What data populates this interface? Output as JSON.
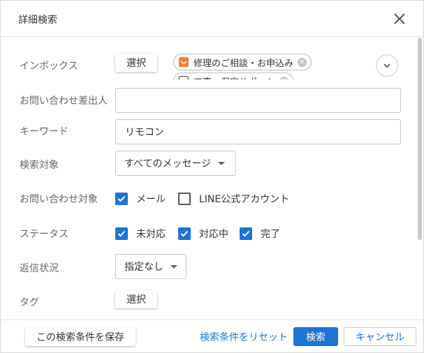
{
  "header": {
    "title": "詳細検索"
  },
  "inbox": {
    "label": "インボックス",
    "select_label": "選択",
    "chips": [
      {
        "label": "修理のご相談・お申込み",
        "icon": "inbox-icon",
        "icon_color": "#f0803c"
      },
      {
        "label": "工事・保守サポート",
        "icon": "inbox-icon",
        "icon_color": "#555555"
      }
    ]
  },
  "sender": {
    "label": "お問い合わせ差出人",
    "value": "",
    "placeholder": ""
  },
  "keyword": {
    "label": "キーワード",
    "value": "リモコン"
  },
  "target": {
    "label": "検索対象",
    "value": "すべてのメッセージ"
  },
  "channel": {
    "label": "お問い合わせ対象",
    "options": [
      {
        "label": "メール",
        "checked": true
      },
      {
        "label": "LINE公式アカウント",
        "checked": false
      }
    ]
  },
  "status": {
    "label": "ステータス",
    "options": [
      {
        "label": "未対応",
        "checked": true
      },
      {
        "label": "対応中",
        "checked": true
      },
      {
        "label": "完了",
        "checked": true
      }
    ]
  },
  "reply": {
    "label": "返信状況",
    "value": "指定なし"
  },
  "tag": {
    "label": "タグ",
    "select_label": "選択"
  },
  "footer": {
    "save_label": "この検索条件を保存",
    "reset_label": "検索条件をリセット",
    "search_label": "検索",
    "cancel_label": "キャンセル"
  },
  "colors": {
    "accent": "#1c74d4",
    "inbox_orange": "#f0803c"
  }
}
